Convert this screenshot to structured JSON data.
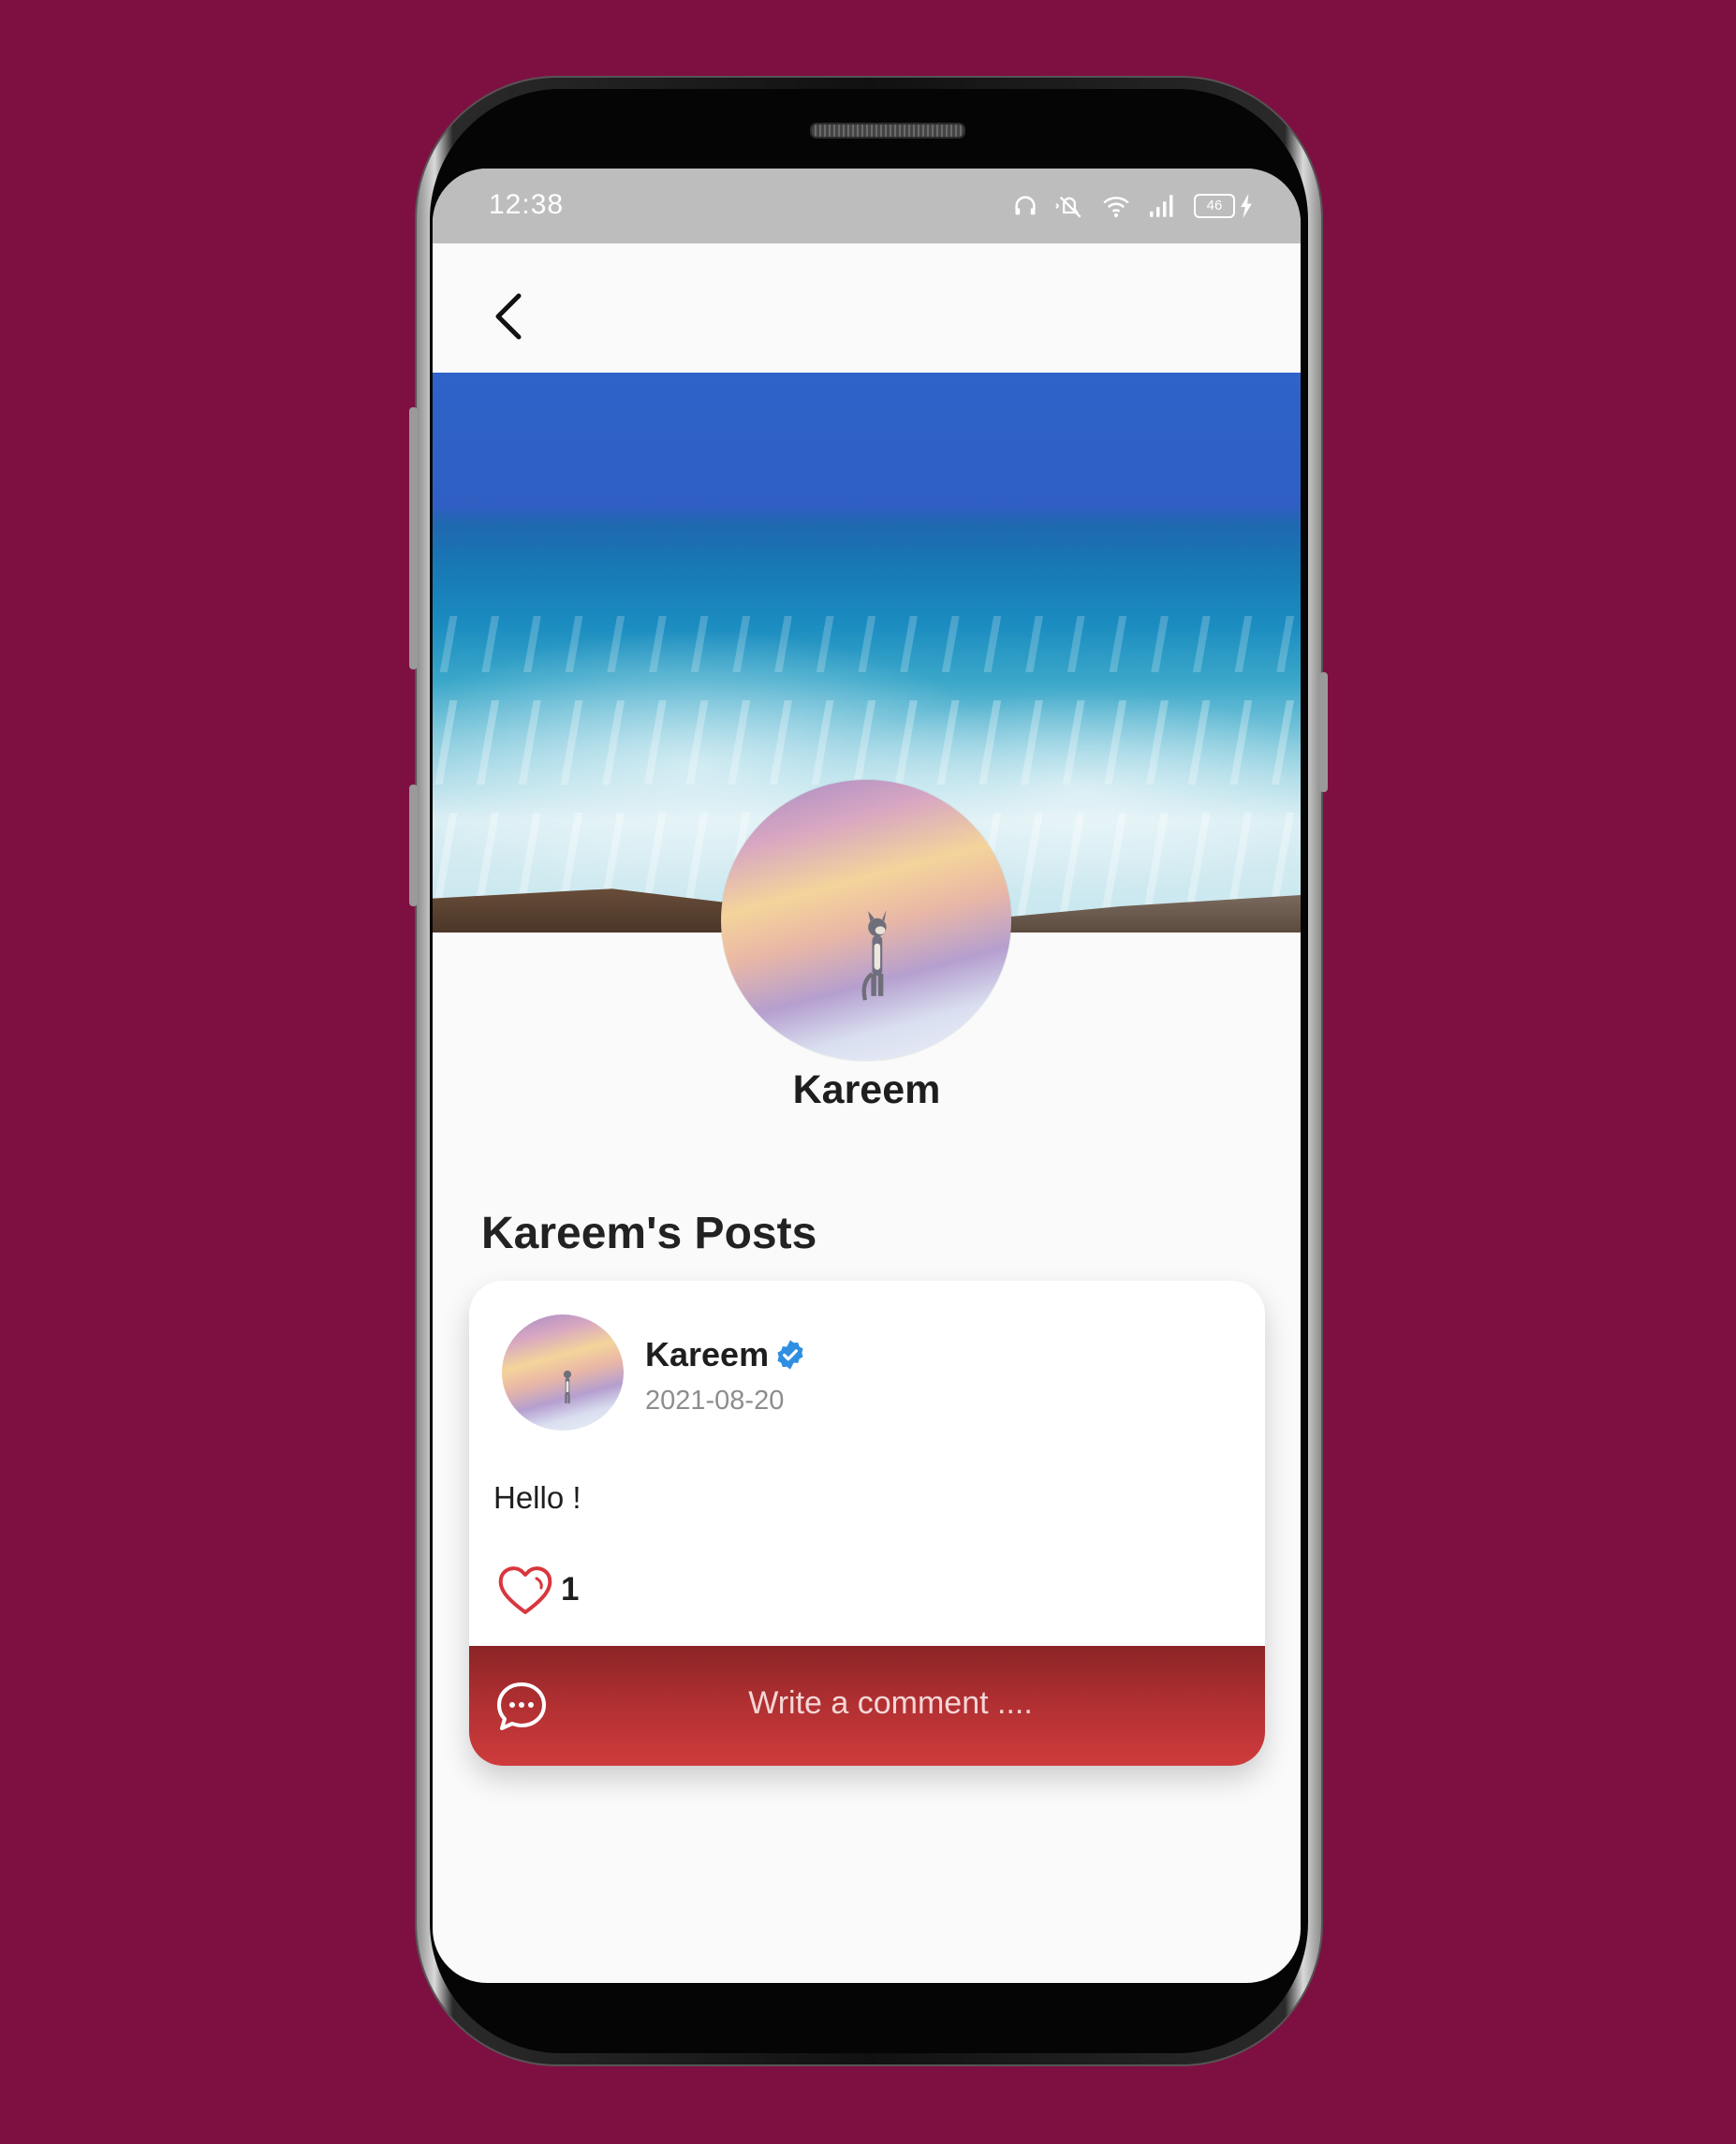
{
  "status_bar": {
    "time": "12:38",
    "battery_level": "46"
  },
  "appbar": {
    "back_icon": "chevron-left-icon"
  },
  "profile": {
    "name": "Kareem"
  },
  "posts_section": {
    "title": "Kareem's Posts"
  },
  "post": {
    "author": "Kareem",
    "verified": true,
    "date": "2021-08-20",
    "text": "Hello !",
    "likes": "1",
    "comment_placeholder": "Write a comment ...."
  },
  "colors": {
    "background": "#7e1041",
    "comment_bar": "#c23a3b",
    "heart": "#d9363e",
    "verified_badge": "#2f8fe0"
  }
}
